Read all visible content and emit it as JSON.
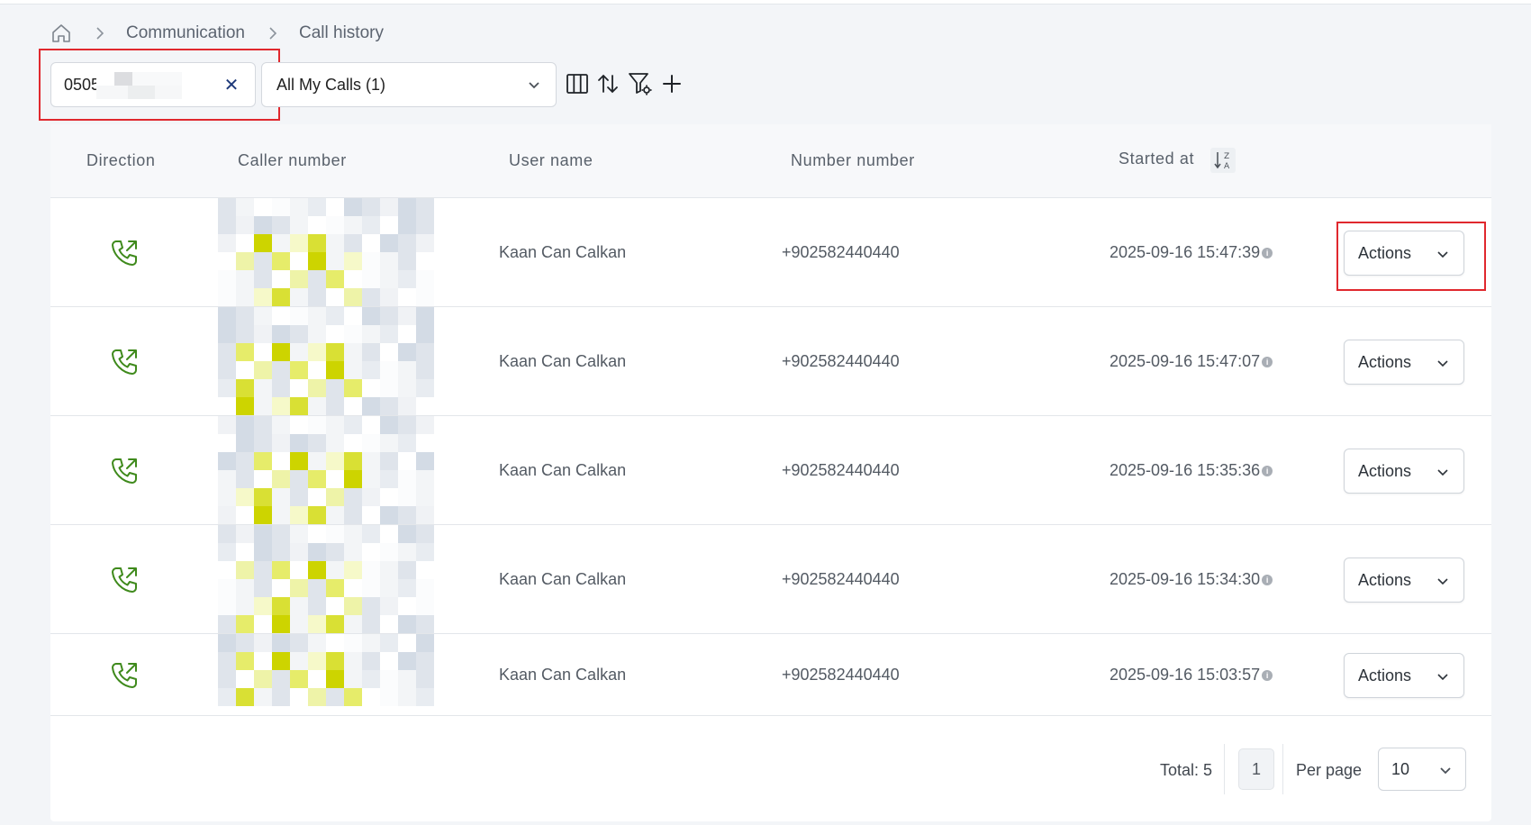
{
  "breadcrumb": {
    "items": [
      "Communication",
      "Call history"
    ]
  },
  "toolbar": {
    "search_value": "0505",
    "filter_select": "All My Calls (1)"
  },
  "table": {
    "columns": [
      "Direction",
      "Caller number",
      "User name",
      "Number number",
      "Started at"
    ],
    "rows": [
      {
        "user": "Kaan Can Calkan",
        "number": "+902582440440",
        "started": "2025-09-16 15:47:39",
        "action": "Actions"
      },
      {
        "user": "Kaan Can Calkan",
        "number": "+902582440440",
        "started": "2025-09-16 15:47:07",
        "action": "Actions"
      },
      {
        "user": "Kaan Can Calkan",
        "number": "+902582440440",
        "started": "2025-09-16 15:35:36",
        "action": "Actions"
      },
      {
        "user": "Kaan Can Calkan",
        "number": "+902582440440",
        "started": "2025-09-16 15:34:30",
        "action": "Actions"
      },
      {
        "user": "Kaan Can Calkan",
        "number": "+902582440440",
        "started": "2025-09-16 15:03:57",
        "action": "Actions"
      }
    ]
  },
  "pagination": {
    "total_label": "Total: 5",
    "current_page": "1",
    "per_page_label": "Per page",
    "per_page_value": "10"
  },
  "colors": {
    "call_icon": "#3f8a1c",
    "highlight": "#e0282e",
    "clear_icon": "#1f3a7a"
  },
  "icons": [
    "home-icon",
    "chevron-right-icon",
    "close-icon",
    "chevron-down-icon",
    "columns-icon",
    "sort-arrows-icon",
    "filter-settings-icon",
    "plus-icon",
    "sort-z-a-icon",
    "outgoing-call-icon",
    "info-icon"
  ]
}
